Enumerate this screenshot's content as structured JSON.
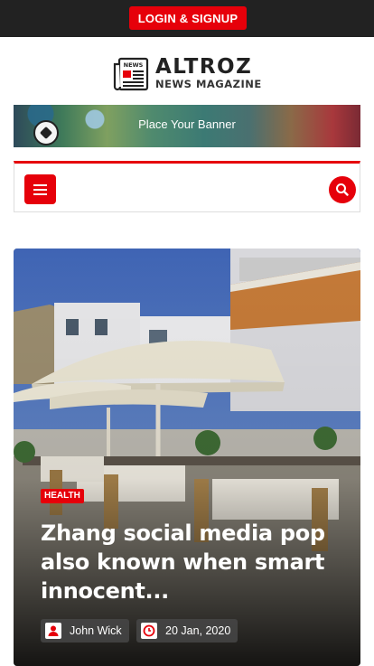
{
  "topbar": {
    "login_label": "LOGIN & SIGNUP"
  },
  "logo": {
    "badge": "NEWS",
    "title": "ALTROZ",
    "subtitle": "NEWS MAGAZINE"
  },
  "banner": {
    "text": "Place Your Banner"
  },
  "nav": {
    "menu_icon": "hamburger-icon",
    "search_icon": "search-icon"
  },
  "featured": {
    "category": "HEALTH",
    "headline": "Zhang social media pop also known when smart innocent...",
    "author": "John Wick",
    "date": "20 Jan, 2020",
    "author_icon": "user-icon",
    "date_icon": "clock-icon"
  },
  "colors": {
    "accent": "#e6000a",
    "topbar": "#222222"
  }
}
